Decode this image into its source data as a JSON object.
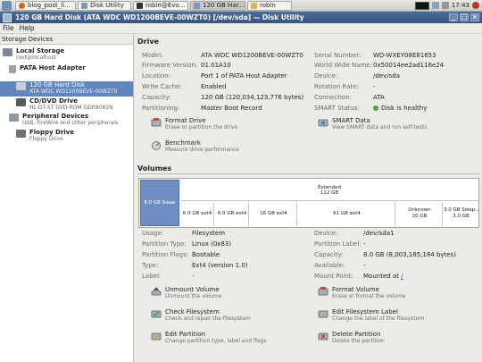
{
  "taskbar": {
    "tasks": [
      {
        "label": "",
        "color": "#6f8fb8"
      },
      {
        "label": "blog_post_li...",
        "color": "#d35f29"
      },
      {
        "label": "Disk Utility",
        "color": "#7d98c0"
      },
      {
        "label": "robin@Evo...",
        "color": "#333333"
      },
      {
        "label": "120 GB Har...",
        "color": "#7d98c0"
      },
      {
        "label": "robin",
        "color": "#e3b547"
      }
    ],
    "clock": "17:43"
  },
  "window": {
    "title": "120 GB Hard Disk (ATA WDC WD1200BEVE-00WZT0) [/dev/sda] — Disk Utility",
    "close": "×",
    "min": "_",
    "max": "□"
  },
  "menu": {
    "file": "File",
    "help": "Help"
  },
  "sidebar": {
    "header": "Storage Devices",
    "items": [
      {
        "t1": "Local Storage",
        "t2": "root@localhost"
      },
      {
        "t1": "PATA Host Adapter",
        "t2": ""
      },
      {
        "t1": "120 GB Hard Disk",
        "t2": "ATA WDC WD1200BEVE-00WZT0"
      },
      {
        "t1": "CD/DVD Drive",
        "t2": "HL-DT-ST DVD-ROM GDR8082N"
      },
      {
        "t1": "Peripheral Devices",
        "t2": "USB, FireWire and other peripherals"
      },
      {
        "t1": "Floppy Drive",
        "t2": "Floppy Drive"
      }
    ]
  },
  "drive": {
    "section_title": "Drive",
    "left": [
      {
        "label": "Model:",
        "value": "ATA WDC WD1200BEVE-00WZT0"
      },
      {
        "label": "Firmware Version:",
        "value": "01.01A10"
      },
      {
        "label": "Location:",
        "value": "Port 1 of PATA Host Adapter"
      },
      {
        "label": "Write Cache:",
        "value": "Enabled"
      },
      {
        "label": "Capacity:",
        "value": "120 GB (120,034,123,776 bytes)"
      },
      {
        "label": "Partitioning:",
        "value": "Master Boot Record"
      }
    ],
    "right": [
      {
        "label": "Serial Number:",
        "value": "WD-WXEY08E81653"
      },
      {
        "label": "World Wide Name:",
        "value": "0x50014ee2ad116e24"
      },
      {
        "label": "Device:",
        "value": "/dev/sda"
      },
      {
        "label": "Rotation Rate:",
        "value": "-"
      },
      {
        "label": "Connection:",
        "value": "ATA"
      },
      {
        "label": "SMART Status:",
        "value": "Disk is healthy"
      }
    ],
    "actions": [
      {
        "title": "Format Drive",
        "desc": "Erase or partition the drive"
      },
      {
        "title": "SMART Data",
        "desc": "View SMART data and run self-tests"
      },
      {
        "title": "Benchmark",
        "desc": "Measure drive performance"
      }
    ]
  },
  "volumes": {
    "section_title": "Volumes",
    "partitions": [
      {
        "label": "8.0 GB Swap"
      },
      {
        "label": "Extended",
        "size": "112 GB"
      },
      {
        "label": "6.0 GB ext4"
      },
      {
        "label": "6.0 GB ext4"
      },
      {
        "label": "16 GB ext4"
      },
      {
        "label": "61 GB ext4"
      },
      {
        "label": "Unknown",
        "size": "20 GB"
      },
      {
        "label": "3.0 GB Swap...",
        "size": "3.0 GB"
      }
    ],
    "left": [
      {
        "label": "Usage:",
        "value": "Filesystem"
      },
      {
        "label": "Partition Type:",
        "value": "Linux (0x83)"
      },
      {
        "label": "Partition Flags:",
        "value": "Bootable"
      },
      {
        "label": "Type:",
        "value": "Ext4 (version 1.0)"
      },
      {
        "label": "Label:",
        "value": "-"
      }
    ],
    "right": [
      {
        "label": "Device:",
        "value": "/dev/sda1"
      },
      {
        "label": "Partition Label:",
        "value": "-"
      },
      {
        "label": "Capacity:",
        "value": "8.0 GB (8,003,165,184 bytes)"
      },
      {
        "label": "Available:",
        "value": "-"
      },
      {
        "label": "Mount Point:",
        "value": "Mounted at",
        "link": "/"
      }
    ],
    "actions": [
      {
        "title": "Unmount Volume",
        "desc": "Unmount the volume"
      },
      {
        "title": "Format Volume",
        "desc": "Erase or format the volume"
      },
      {
        "title": "Check Filesystem",
        "desc": "Check and repair the filesystem"
      },
      {
        "title": "Edit Filesystem Label",
        "desc": "Change the label of the filesystem"
      },
      {
        "title": "Edit Partition",
        "desc": "Change partition type, label and flags"
      },
      {
        "title": "Delete Partition",
        "desc": "Delete the partition"
      }
    ]
  }
}
